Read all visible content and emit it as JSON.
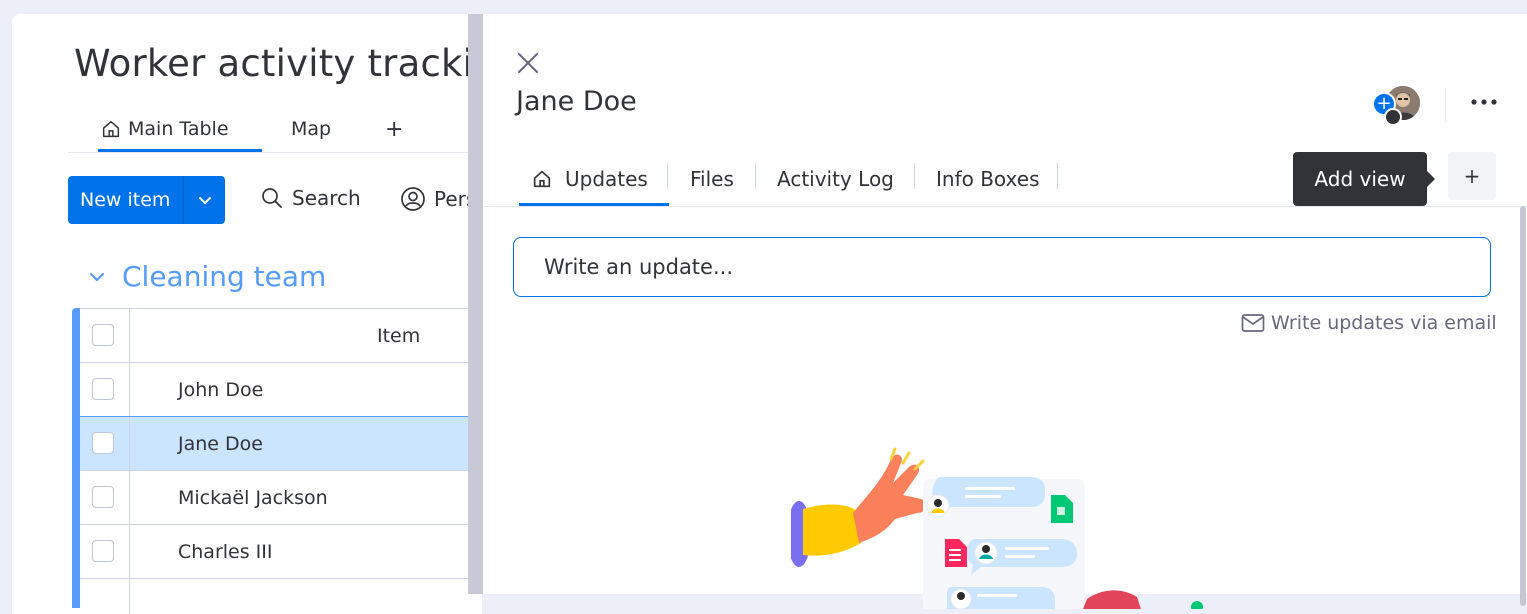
{
  "board": {
    "title": "Worker activity tracking",
    "views": [
      {
        "label": "Main Table",
        "active": true
      },
      {
        "label": "Map",
        "active": false
      },
      {
        "label": "+",
        "active": false
      }
    ],
    "new_item_label": "New item",
    "search_label": "Search",
    "person_label": "Person",
    "group": {
      "name": "Cleaning team",
      "color": "#579bfc",
      "column_header": "Item",
      "rows": [
        {
          "name": "John Doe",
          "selected": false
        },
        {
          "name": "Jane Doe",
          "selected": true
        },
        {
          "name": "Mickaël Jackson",
          "selected": false
        },
        {
          "name": "Charles III",
          "selected": false
        }
      ]
    }
  },
  "panel": {
    "item_title": "Jane Doe",
    "tabs": [
      {
        "label": "Updates",
        "active": true
      },
      {
        "label": "Files",
        "active": false
      },
      {
        "label": "Activity Log",
        "active": false
      },
      {
        "label": "Info Boxes",
        "active": false
      }
    ],
    "tooltip": "Add view",
    "add_view_button": "+",
    "update_placeholder": "Write an update...",
    "email_link": "Write updates via email"
  },
  "colors": {
    "primary": "#0073ea",
    "group_blue": "#579bfc",
    "selected_row": "#cce5ff",
    "text": "#323338",
    "tooltip_bg": "#323338"
  },
  "icons": [
    "home-icon",
    "search-icon",
    "person-icon",
    "chevron-down-icon",
    "close-icon",
    "more-icon",
    "mail-icon",
    "plus-icon"
  ]
}
